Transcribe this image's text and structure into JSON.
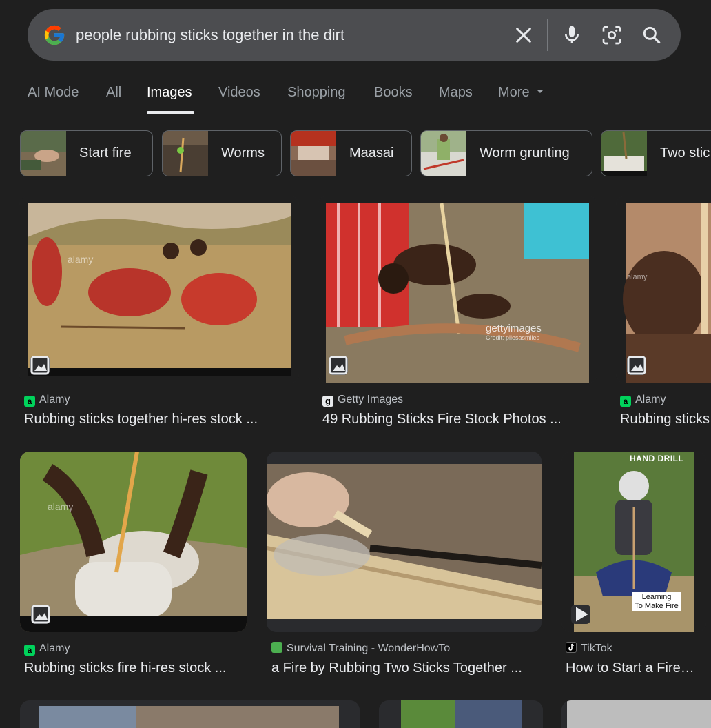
{
  "search": {
    "query": "people rubbing sticks together in the dirt",
    "icons": [
      "google-g-icon",
      "clear-icon",
      "microphone-icon",
      "lens-icon",
      "search-icon"
    ]
  },
  "tabs": [
    {
      "label": "AI Mode"
    },
    {
      "label": "All"
    },
    {
      "label": "Images",
      "active": true
    },
    {
      "label": "Videos"
    },
    {
      "label": "Shopping"
    },
    {
      "label": "Books"
    },
    {
      "label": "Maps"
    },
    {
      "label": "More"
    }
  ],
  "chips": [
    {
      "label": "Start fire"
    },
    {
      "label": "Worms"
    },
    {
      "label": "Maasai"
    },
    {
      "label": "Worm grunting"
    },
    {
      "label": "Two stic"
    }
  ],
  "results": [
    {
      "source": "Alamy",
      "title": "Rubbing sticks together hi-res stock ...",
      "watermark": "alamy"
    },
    {
      "source": "Getty Images",
      "title": "49 Rubbing Sticks Fire Stock Photos ...",
      "watermark": "gettyimages",
      "watermark_sub": "Credit: pilesasmiles"
    },
    {
      "source": "Alamy",
      "title": "Rubbing sticks",
      "watermark": "alamy"
    },
    {
      "source": "Alamy",
      "title": "Rubbing sticks fire hi-res stock ...",
      "watermark": "alamy"
    },
    {
      "source": "Survival Training - WonderHowTo",
      "title": "a Fire by Rubbing Two Sticks Together ..."
    },
    {
      "source": "TikTok",
      "title": "How to Start a Fire…",
      "overlay_top": "HAND DRILL",
      "overlay_bottom_1": "Learning",
      "overlay_bottom_2": "To Make Fire"
    }
  ],
  "colors": {
    "background": "#1f1f1f",
    "searchbar": "#4c4d50",
    "active_tab": "#ffffff",
    "inactive_tab": "#9aa0a6"
  }
}
